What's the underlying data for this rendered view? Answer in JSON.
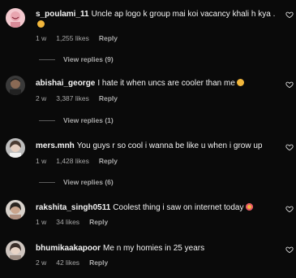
{
  "comments": [
    {
      "username": "s_poulami_11",
      "text": "Uncle ap logo k group mai koi vacancy khali h kya .",
      "time": "1 w",
      "likes": "1,255 likes",
      "reply": "Reply",
      "view_replies": "View replies (9)",
      "emoji": "grinning-sweat-emoji",
      "avatar": "avatar-pink-smile"
    },
    {
      "username": "abishai_george",
      "text": "I hate it when uncs are cooler than me",
      "time": "2 w",
      "likes": "3,387 likes",
      "reply": "Reply",
      "view_replies": "View replies (1)",
      "emoji": "grimace-emoji",
      "avatar": "avatar-man-dark"
    },
    {
      "username": "mers.mnh",
      "text": "You guys r so cool i wanna be like u when i grow up",
      "time": "1 w",
      "likes": "1,428 likes",
      "reply": "Reply",
      "view_replies": "View replies (6)",
      "emoji": "",
      "avatar": "avatar-woman-grey"
    },
    {
      "username": "rakshita_singh0511",
      "text": "Coolest thing i saw on internet today",
      "time": "1 w",
      "likes": "34 likes",
      "reply": "Reply",
      "view_replies": "",
      "emoji": "heart-eyes-emoji",
      "avatar": "avatar-woman-light"
    },
    {
      "username": "bhumikaakapoor",
      "text": "Me n my homies in 25 years",
      "time": "2 w",
      "likes": "42 likes",
      "reply": "Reply",
      "view_replies": "",
      "emoji": "",
      "avatar": "avatar-woman-pale"
    }
  ],
  "colors": {
    "background": "#0a0a0a",
    "text": "#f5f5f5",
    "meta": "#a8a8a8"
  }
}
